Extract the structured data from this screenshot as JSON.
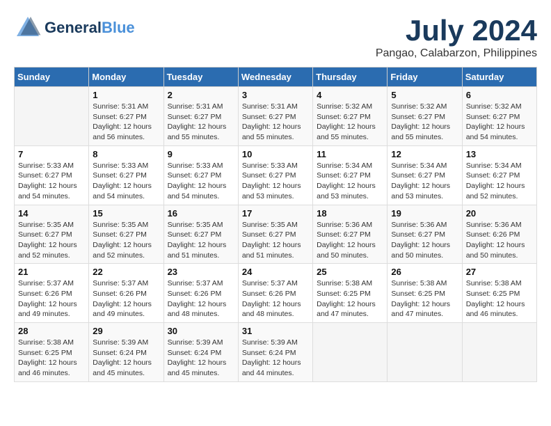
{
  "header": {
    "logo_line1": "General",
    "logo_line2": "Blue",
    "month": "July 2024",
    "location": "Pangao, Calabarzon, Philippines"
  },
  "days_of_week": [
    "Sunday",
    "Monday",
    "Tuesday",
    "Wednesday",
    "Thursday",
    "Friday",
    "Saturday"
  ],
  "weeks": [
    [
      {
        "day": "",
        "info": ""
      },
      {
        "day": "1",
        "info": "Sunrise: 5:31 AM\nSunset: 6:27 PM\nDaylight: 12 hours\nand 56 minutes."
      },
      {
        "day": "2",
        "info": "Sunrise: 5:31 AM\nSunset: 6:27 PM\nDaylight: 12 hours\nand 55 minutes."
      },
      {
        "day": "3",
        "info": "Sunrise: 5:31 AM\nSunset: 6:27 PM\nDaylight: 12 hours\nand 55 minutes."
      },
      {
        "day": "4",
        "info": "Sunrise: 5:32 AM\nSunset: 6:27 PM\nDaylight: 12 hours\nand 55 minutes."
      },
      {
        "day": "5",
        "info": "Sunrise: 5:32 AM\nSunset: 6:27 PM\nDaylight: 12 hours\nand 55 minutes."
      },
      {
        "day": "6",
        "info": "Sunrise: 5:32 AM\nSunset: 6:27 PM\nDaylight: 12 hours\nand 54 minutes."
      }
    ],
    [
      {
        "day": "7",
        "info": "Sunrise: 5:33 AM\nSunset: 6:27 PM\nDaylight: 12 hours\nand 54 minutes."
      },
      {
        "day": "8",
        "info": "Sunrise: 5:33 AM\nSunset: 6:27 PM\nDaylight: 12 hours\nand 54 minutes."
      },
      {
        "day": "9",
        "info": "Sunrise: 5:33 AM\nSunset: 6:27 PM\nDaylight: 12 hours\nand 54 minutes."
      },
      {
        "day": "10",
        "info": "Sunrise: 5:33 AM\nSunset: 6:27 PM\nDaylight: 12 hours\nand 53 minutes."
      },
      {
        "day": "11",
        "info": "Sunrise: 5:34 AM\nSunset: 6:27 PM\nDaylight: 12 hours\nand 53 minutes."
      },
      {
        "day": "12",
        "info": "Sunrise: 5:34 AM\nSunset: 6:27 PM\nDaylight: 12 hours\nand 53 minutes."
      },
      {
        "day": "13",
        "info": "Sunrise: 5:34 AM\nSunset: 6:27 PM\nDaylight: 12 hours\nand 52 minutes."
      }
    ],
    [
      {
        "day": "14",
        "info": "Sunrise: 5:35 AM\nSunset: 6:27 PM\nDaylight: 12 hours\nand 52 minutes."
      },
      {
        "day": "15",
        "info": "Sunrise: 5:35 AM\nSunset: 6:27 PM\nDaylight: 12 hours\nand 52 minutes."
      },
      {
        "day": "16",
        "info": "Sunrise: 5:35 AM\nSunset: 6:27 PM\nDaylight: 12 hours\nand 51 minutes."
      },
      {
        "day": "17",
        "info": "Sunrise: 5:35 AM\nSunset: 6:27 PM\nDaylight: 12 hours\nand 51 minutes."
      },
      {
        "day": "18",
        "info": "Sunrise: 5:36 AM\nSunset: 6:27 PM\nDaylight: 12 hours\nand 50 minutes."
      },
      {
        "day": "19",
        "info": "Sunrise: 5:36 AM\nSunset: 6:27 PM\nDaylight: 12 hours\nand 50 minutes."
      },
      {
        "day": "20",
        "info": "Sunrise: 5:36 AM\nSunset: 6:26 PM\nDaylight: 12 hours\nand 50 minutes."
      }
    ],
    [
      {
        "day": "21",
        "info": "Sunrise: 5:37 AM\nSunset: 6:26 PM\nDaylight: 12 hours\nand 49 minutes."
      },
      {
        "day": "22",
        "info": "Sunrise: 5:37 AM\nSunset: 6:26 PM\nDaylight: 12 hours\nand 49 minutes."
      },
      {
        "day": "23",
        "info": "Sunrise: 5:37 AM\nSunset: 6:26 PM\nDaylight: 12 hours\nand 48 minutes."
      },
      {
        "day": "24",
        "info": "Sunrise: 5:37 AM\nSunset: 6:26 PM\nDaylight: 12 hours\nand 48 minutes."
      },
      {
        "day": "25",
        "info": "Sunrise: 5:38 AM\nSunset: 6:25 PM\nDaylight: 12 hours\nand 47 minutes."
      },
      {
        "day": "26",
        "info": "Sunrise: 5:38 AM\nSunset: 6:25 PM\nDaylight: 12 hours\nand 47 minutes."
      },
      {
        "day": "27",
        "info": "Sunrise: 5:38 AM\nSunset: 6:25 PM\nDaylight: 12 hours\nand 46 minutes."
      }
    ],
    [
      {
        "day": "28",
        "info": "Sunrise: 5:38 AM\nSunset: 6:25 PM\nDaylight: 12 hours\nand 46 minutes."
      },
      {
        "day": "29",
        "info": "Sunrise: 5:39 AM\nSunset: 6:24 PM\nDaylight: 12 hours\nand 45 minutes."
      },
      {
        "day": "30",
        "info": "Sunrise: 5:39 AM\nSunset: 6:24 PM\nDaylight: 12 hours\nand 45 minutes."
      },
      {
        "day": "31",
        "info": "Sunrise: 5:39 AM\nSunset: 6:24 PM\nDaylight: 12 hours\nand 44 minutes."
      },
      {
        "day": "",
        "info": ""
      },
      {
        "day": "",
        "info": ""
      },
      {
        "day": "",
        "info": ""
      }
    ]
  ]
}
